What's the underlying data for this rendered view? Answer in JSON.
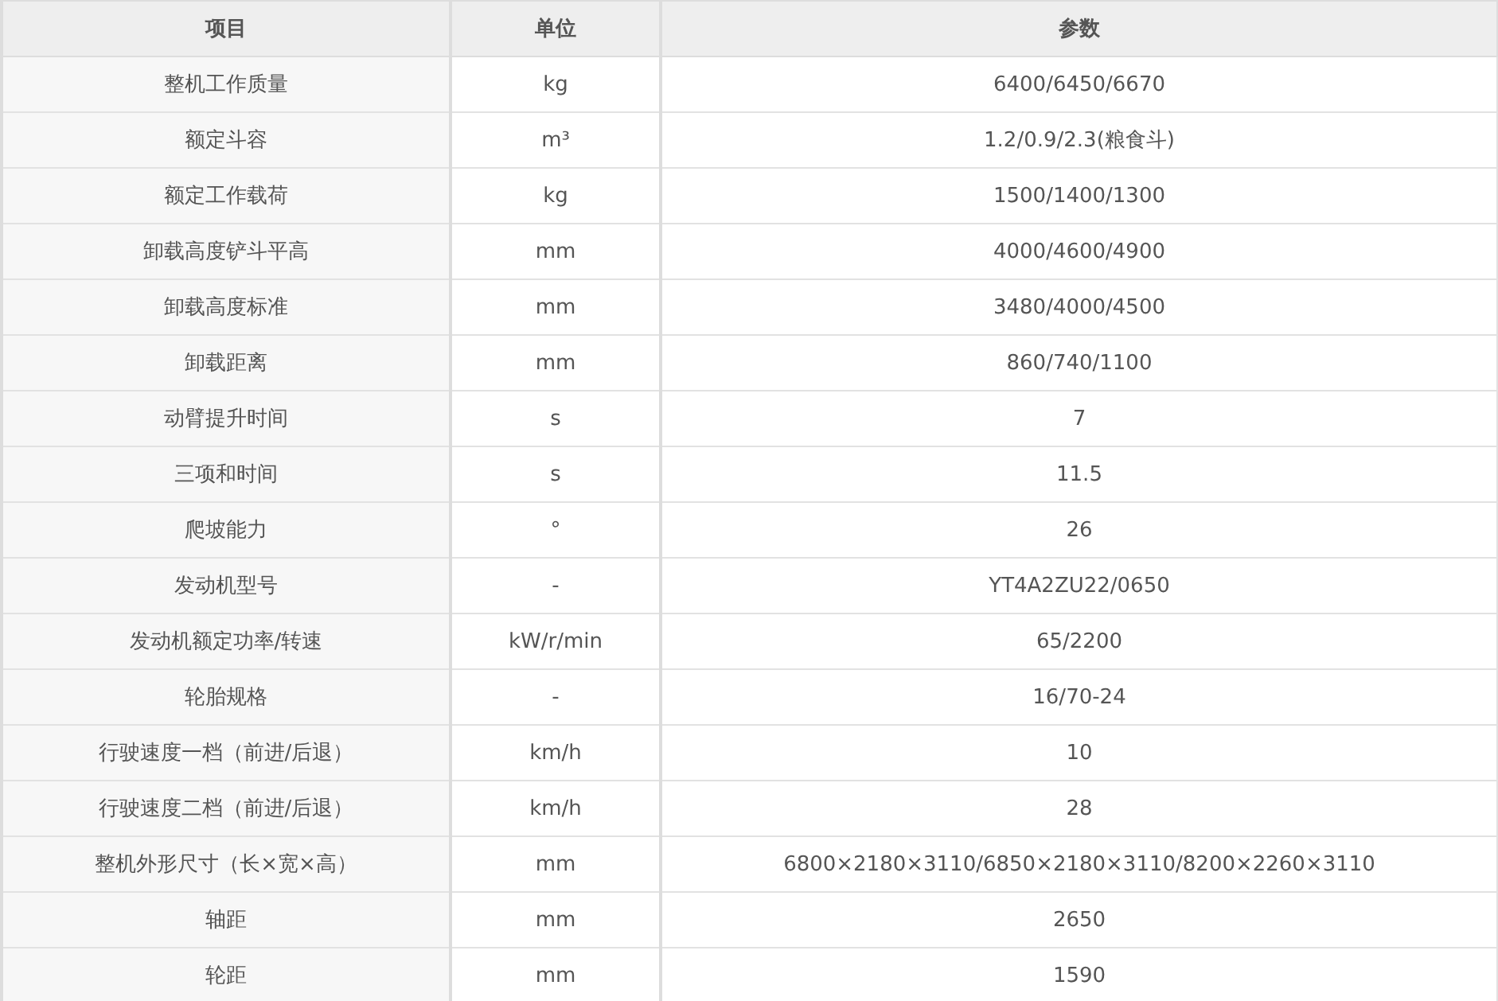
{
  "table": {
    "columns": [
      "项目",
      "单位",
      "参数"
    ],
    "rows": [
      [
        "整机工作质量",
        "kg",
        "6400/6450/6670"
      ],
      [
        "额定斗容",
        "m³",
        "1.2/0.9/2.3(粮食斗)"
      ],
      [
        "额定工作载荷",
        "kg",
        "1500/1400/1300"
      ],
      [
        "卸载高度铲斗平高",
        "mm",
        "4000/4600/4900"
      ],
      [
        "卸载高度标准",
        "mm",
        "3480/4000/4500"
      ],
      [
        "卸载距离",
        "mm",
        "860/740/1100"
      ],
      [
        "动臂提升时间",
        "s",
        "7"
      ],
      [
        "三项和时间",
        "s",
        "11.5"
      ],
      [
        "爬坡能力",
        "°",
        "26"
      ],
      [
        "发动机型号",
        "-",
        "YT4A2ZU22/0650"
      ],
      [
        "发动机额定功率/转速",
        "kW/r/min",
        "65/2200"
      ],
      [
        "轮胎规格",
        "-",
        "16/70-24"
      ],
      [
        "行驶速度一档（前进/后退）",
        "km/h",
        "10"
      ],
      [
        "行驶速度二档（前进/后退）",
        "km/h",
        "28"
      ],
      [
        "整机外形尺寸（长×宽×高）",
        "mm",
        "6800×2180×3110/6850×2180×3110/8200×2260×3110"
      ],
      [
        "轴距",
        "mm",
        "2650"
      ],
      [
        "轮距",
        "mm",
        "1590"
      ]
    ]
  }
}
